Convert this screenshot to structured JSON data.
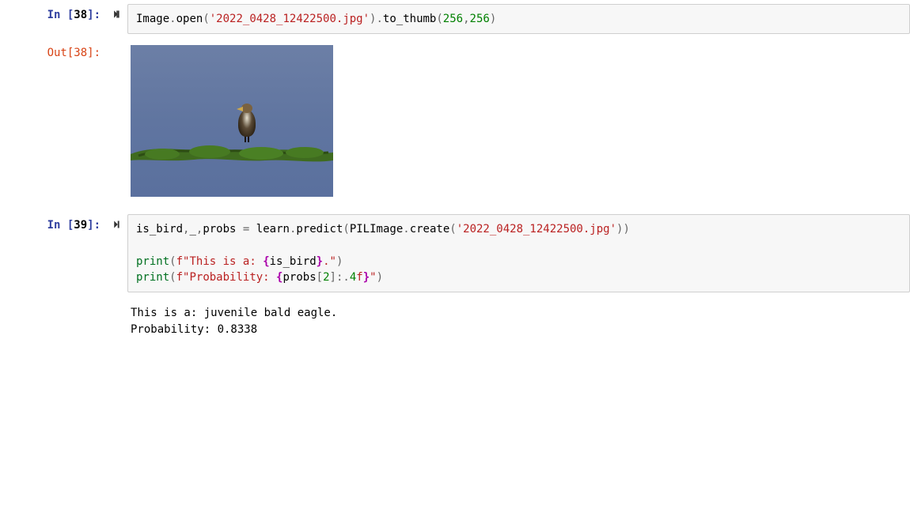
{
  "cells": [
    {
      "exec_count": 38,
      "in_label": "In [",
      "in_close": "]:",
      "out_label": "Out[",
      "code_tokens": {
        "p1": "Image",
        "dot1": ".",
        "open": "open",
        "lp1": "(",
        "str1": "'2022_0428_12422500.jpg'",
        "rp1": ")",
        "dot2": ".",
        "tothumb": "to_thumb",
        "lp2": "(",
        "n1": "256",
        "comma": ",",
        "n2": "256",
        "rp2": ")"
      }
    },
    {
      "exec_count": 39,
      "in_label": "In [",
      "in_close": "]:",
      "code": {
        "l1": {
          "a": "is_bird",
          "c1": ",",
          "u": "_",
          "c2": ",",
          "p": "probs",
          "eq": " = ",
          "b": "learn",
          "d1": ".",
          "pr": "predict",
          "lp": "(",
          "pil": "PILImage",
          "d2": ".",
          "cr": "create",
          "lp2": "(",
          "s": "'2022_0428_12422500.jpg'",
          "rp2": ")",
          "rp": ")"
        },
        "l3": {
          "pf": "print",
          "lp": "(",
          "f": "f",
          "s1": "\"This is a: ",
          "br1": "{",
          "v": "is_bird",
          "br2": "}",
          "s2": ".\"",
          "rp": ")"
        },
        "l4": {
          "pf": "print",
          "lp": "(",
          "f": "f",
          "s1": "\"Probability: ",
          "br1": "{",
          "v": "probs",
          "lb": "[",
          "n": "2",
          "rb": "]:.",
          "n2": "4",
          "fmt": "f",
          "br2": "}",
          "s2": "\"",
          "rp": ")"
        }
      },
      "output_text": "This is a: juvenile bald eagle.\nProbability: 0.8338"
    }
  ]
}
